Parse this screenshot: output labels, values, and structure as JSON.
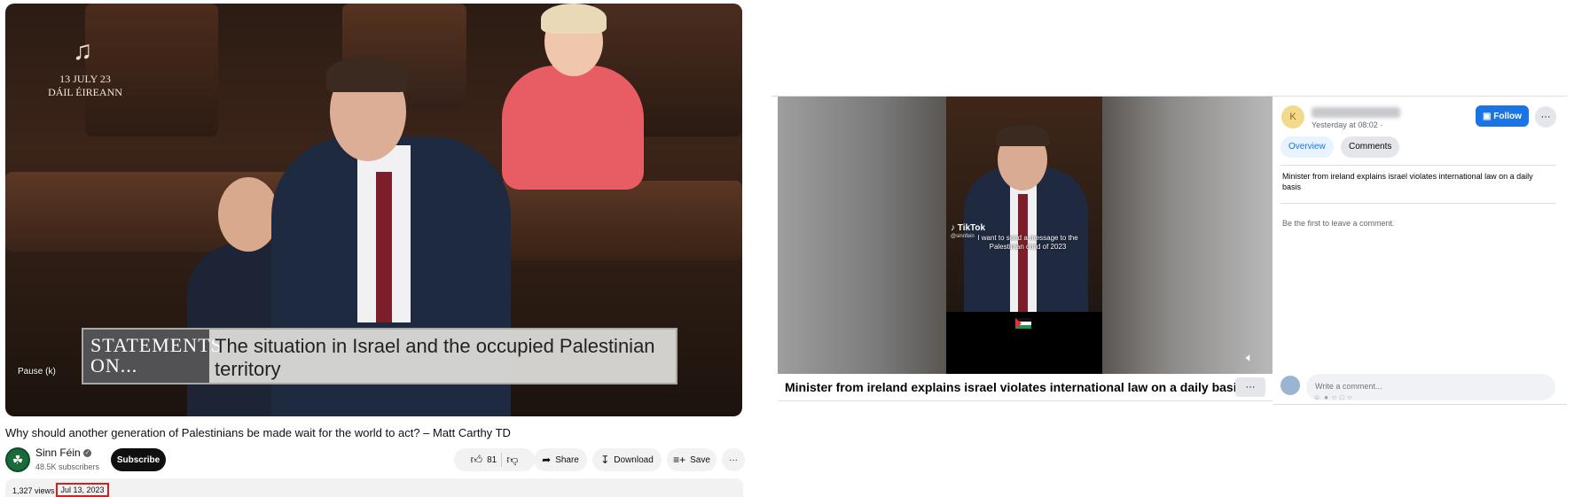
{
  "youtube": {
    "video": {
      "broadcaster_icon": "harp-icon",
      "date_line1": "13 JULY 23",
      "date_line2": "DÁIL ÉIREANN",
      "lower_third_left": "STATEMENTS ON...",
      "lower_third_right": "The situation in Israel and the occupied Palestinian territory",
      "pause_tooltip": "Pause (k)"
    },
    "title": "Why should another generation of Palestinians be made wait for the world to act? – Matt Carthy TD",
    "channel": {
      "name": "Sinn Féin",
      "verified_icon": "verified-check-icon",
      "subscribers": "48.5K subscribers",
      "subscribe_label": "Subscribe"
    },
    "actions": {
      "like_count": "81",
      "share_label": "Share",
      "download_label": "Download",
      "save_label": "Save",
      "more_label": "···"
    },
    "meta": {
      "views": "1,327 views",
      "date": "Jul 13, 2023"
    }
  },
  "facebook": {
    "video": {
      "tiktok_label": "TikTok",
      "tiktok_handle": "@sinnfein",
      "caption": "I want to send a message to the Palestinian child of 2023",
      "mute_icon": "speaker-icon"
    },
    "post_title": "Minister from ireland explains israel violates international law on a daily basis",
    "more_button": "···",
    "side": {
      "avatar_letter": "K",
      "time": "Yesterday at 08:02 ·",
      "follow_label": "Follow",
      "dots_label": "···",
      "tabs": [
        "Overview",
        "Comments"
      ],
      "description": "Minister from ireland explains israel violates international law on a daily basis",
      "first_comment": "Be the first to leave a comment.",
      "comment_placeholder": "Write a comment..."
    }
  },
  "colors": {
    "yt_subscribe_bg": "#0f0f0f",
    "highlight_red": "#d21f1f",
    "fb_blue": "#1b74e4"
  }
}
